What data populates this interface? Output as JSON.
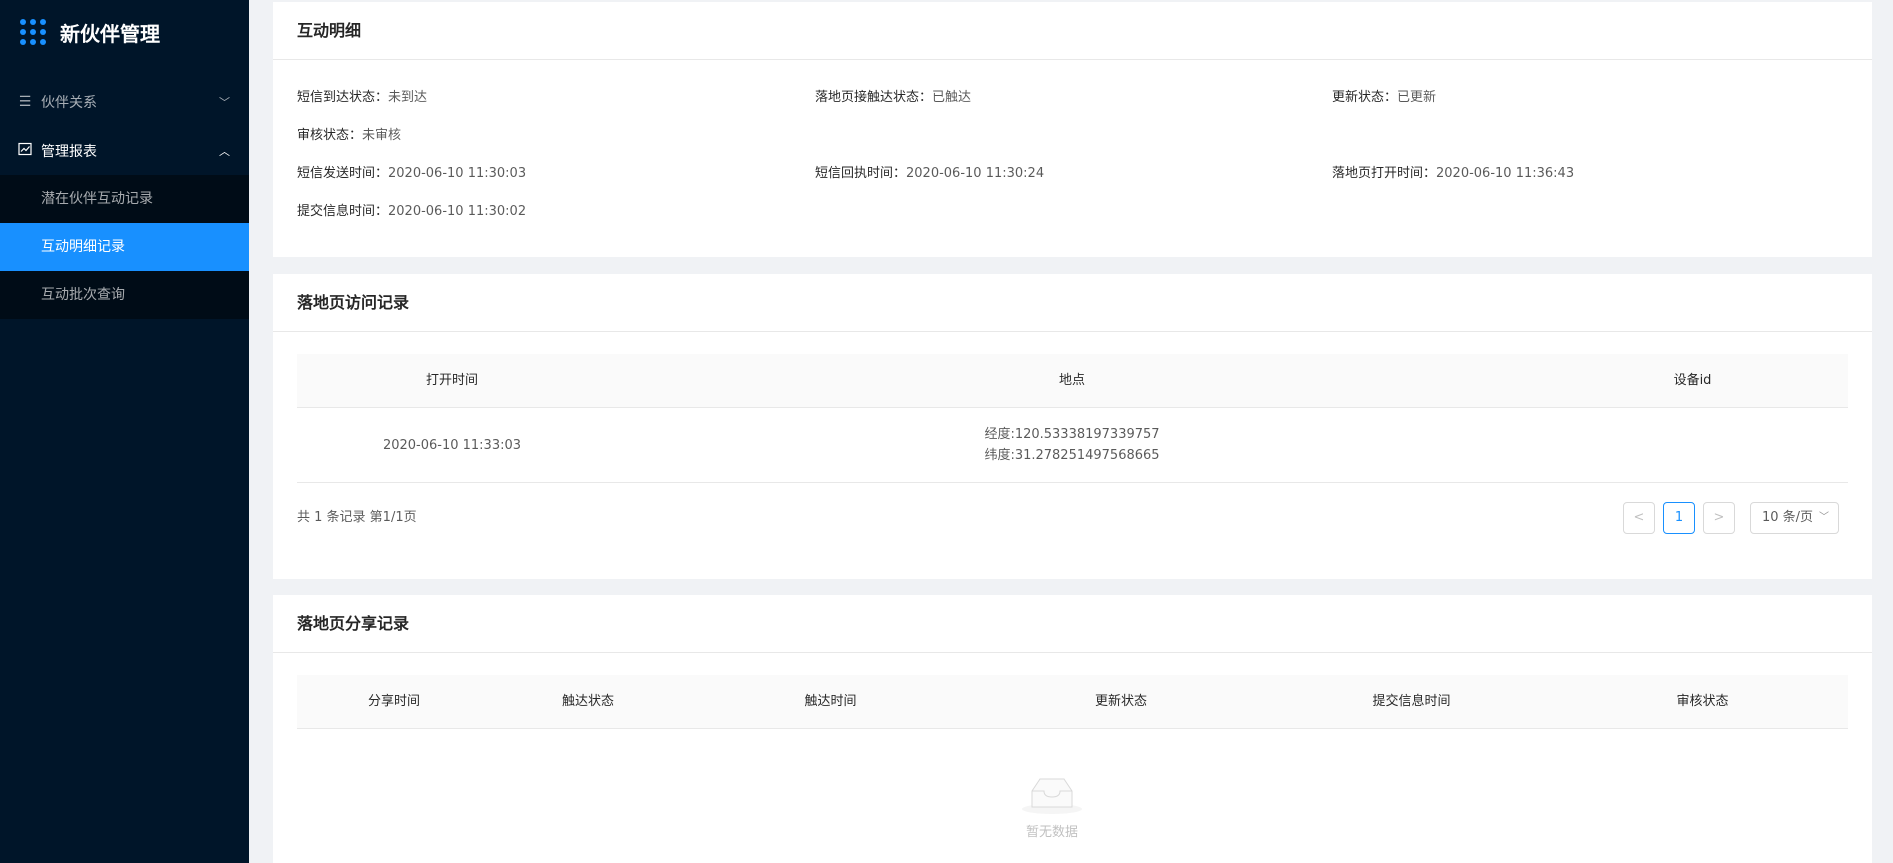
{
  "app": {
    "title": "新伙伴管理",
    "logo_icon": "grid-dots-icon"
  },
  "colors": {
    "sidebar_bg": "#001529",
    "submenu_bg": "#000c17",
    "accent": "#1890ff"
  },
  "sidebar": {
    "groups": [
      {
        "label": "伙伴关系",
        "icon": "list-icon",
        "open": false
      },
      {
        "label": "管理报表",
        "icon": "chart-icon",
        "open": true
      }
    ],
    "sub_items": [
      {
        "label": "潜在伙伴互动记录",
        "active": false
      },
      {
        "label": "互动明细记录",
        "active": true
      },
      {
        "label": "互动批次查询",
        "active": false
      }
    ]
  },
  "detail": {
    "title": "互动明细",
    "fields": [
      {
        "label": "短信到达状态：",
        "value": "未到达"
      },
      {
        "label": "落地页接触达状态：",
        "value": "已触达"
      },
      {
        "label": "更新状态：",
        "value": "已更新"
      },
      {
        "label": "审核状态：",
        "value": "未审核"
      },
      {
        "label": "短信发送时间：",
        "value": "2020-06-10 11:30:03"
      },
      {
        "label": "短信回执时间：",
        "value": "2020-06-10 11:30:24"
      },
      {
        "label": "落地页打开时间：",
        "value": "2020-06-10 11:36:43"
      },
      {
        "label": "提交信息时间：",
        "value": "2020-06-10 11:30:02"
      }
    ]
  },
  "visits": {
    "title": "落地页访问记录",
    "columns": [
      "打开时间",
      "地点",
      "设备id"
    ],
    "rows": [
      {
        "open_time": "2020-06-10 11:33:03",
        "lng": "经度:120.53338197339757",
        "lat": "纬度:31.278251497568665",
        "device_id": ""
      }
    ],
    "pager": {
      "total_text": "共 1 条记录 第1/1页",
      "current_page": "1",
      "prev": "<",
      "next": ">",
      "page_size": "10 条/页"
    }
  },
  "shares": {
    "title": "落地页分享记录",
    "columns": [
      "分享时间",
      "触达状态",
      "触达时间",
      "更新状态",
      "提交信息时间",
      "审核状态"
    ],
    "empty_text": "暂无数据"
  }
}
